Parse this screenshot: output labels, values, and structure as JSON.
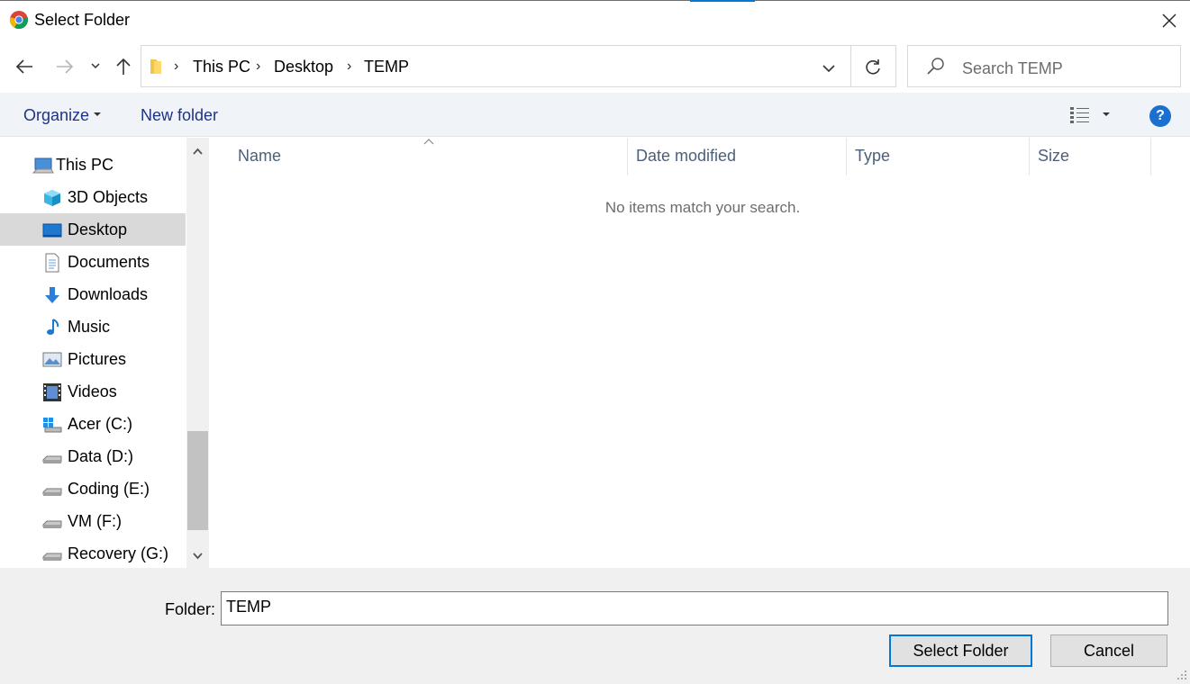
{
  "window": {
    "title": "Select Folder",
    "app_icon": "chrome-icon",
    "close_icon": "close-icon"
  },
  "nav": {
    "back_icon": "back-arrow-icon",
    "forward_icon": "forward-arrow-icon",
    "recent_icon": "chevron-down-icon",
    "up_icon": "up-arrow-icon",
    "address": {
      "folder_icon": "folder-icon",
      "crumbs": [
        "This PC",
        "Desktop",
        "TEMP"
      ],
      "separator": "›",
      "dropdown_icon": "chevron-down-icon",
      "refresh_icon": "refresh-icon"
    },
    "search": {
      "placeholder": "Search TEMP",
      "icon": "search-icon"
    }
  },
  "toolbar": {
    "organize_label": "Organize",
    "new_folder_label": "New folder",
    "view_icon": "details-view-icon",
    "help_label": "?"
  },
  "sidebar": {
    "items": [
      {
        "label": "This PC",
        "icon": "pc-icon",
        "selected": false
      },
      {
        "label": "3D Objects",
        "icon": "3d-objects-icon",
        "selected": false
      },
      {
        "label": "Desktop",
        "icon": "desktop-icon",
        "selected": true
      },
      {
        "label": "Documents",
        "icon": "documents-icon",
        "selected": false
      },
      {
        "label": "Downloads",
        "icon": "downloads-icon",
        "selected": false
      },
      {
        "label": "Music",
        "icon": "music-icon",
        "selected": false
      },
      {
        "label": "Pictures",
        "icon": "pictures-icon",
        "selected": false
      },
      {
        "label": "Videos",
        "icon": "videos-icon",
        "selected": false
      },
      {
        "label": "Acer (C:)",
        "icon": "system-drive-icon",
        "selected": false
      },
      {
        "label": "Data (D:)",
        "icon": "drive-icon",
        "selected": false
      },
      {
        "label": "Coding (E:)",
        "icon": "drive-icon",
        "selected": false
      },
      {
        "label": "VM (F:)",
        "icon": "drive-icon",
        "selected": false
      },
      {
        "label": "Recovery (G:)",
        "icon": "drive-icon",
        "selected": false
      }
    ]
  },
  "content": {
    "columns": [
      "Name",
      "Date modified",
      "Type",
      "Size"
    ],
    "empty_message": "No items match your search."
  },
  "footer": {
    "folder_label": "Folder:",
    "folder_value": "TEMP",
    "select_label": "Select Folder",
    "cancel_label": "Cancel"
  },
  "colors": {
    "accent": "#0078d7",
    "toolbar_bg": "#f0f4f9",
    "selection_bg": "#d9d9d9",
    "help_bg": "#1a6fd1"
  }
}
